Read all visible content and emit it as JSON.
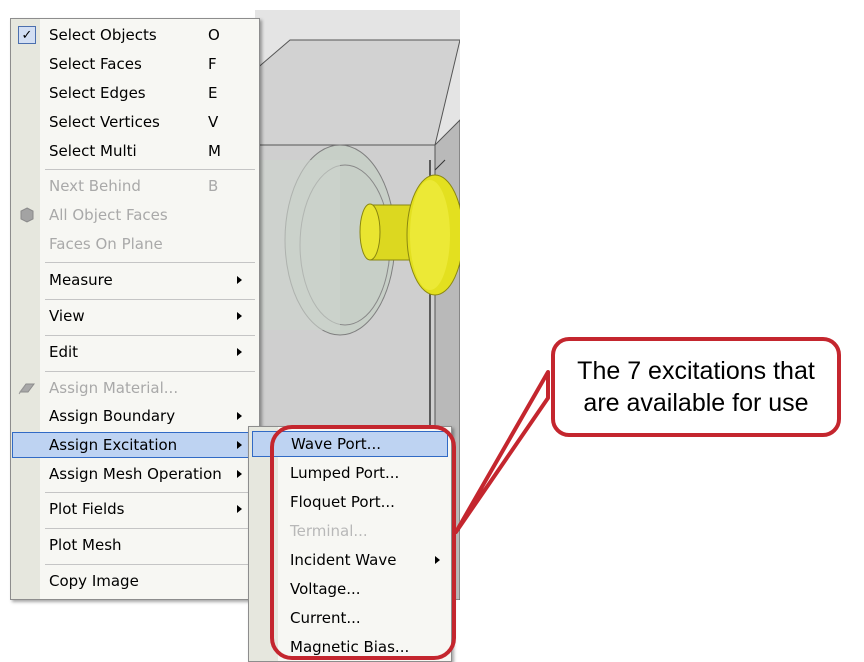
{
  "menu": {
    "items": [
      {
        "label": "Select Objects",
        "accel": "O",
        "checked": true
      },
      {
        "label": "Select Faces",
        "accel": "F"
      },
      {
        "label": "Select Edges",
        "accel": "E"
      },
      {
        "label": "Select Vertices",
        "accel": "V"
      },
      {
        "label": "Select Multi",
        "accel": "M"
      },
      {
        "label": "Next Behind",
        "accel": "B",
        "disabled": true
      },
      {
        "label": "All Object Faces",
        "disabled": true,
        "icon": "object-faces-icon"
      },
      {
        "label": "Faces On Plane",
        "disabled": true
      },
      {
        "label": "Measure",
        "submenu": true
      },
      {
        "label": "View",
        "submenu": true
      },
      {
        "label": "Edit",
        "submenu": true
      },
      {
        "label": "Assign Material...",
        "disabled": true,
        "icon": "material-icon"
      },
      {
        "label": "Assign Boundary",
        "submenu": true
      },
      {
        "label": "Assign Excitation",
        "submenu": true,
        "highlighted": true
      },
      {
        "label": "Assign Mesh Operation",
        "submenu": true
      },
      {
        "label": "Plot Fields",
        "submenu": true
      },
      {
        "label": "Plot Mesh"
      },
      {
        "label": "Copy Image"
      }
    ]
  },
  "submenu": {
    "items": [
      {
        "label": "Wave Port...",
        "highlighted": true
      },
      {
        "label": "Lumped Port..."
      },
      {
        "label": "Floquet Port..."
      },
      {
        "label": "Terminal...",
        "disabled": true
      },
      {
        "label": "Incident Wave",
        "submenu": true
      },
      {
        "label": "Voltage..."
      },
      {
        "label": "Current..."
      },
      {
        "label": "Magnetic Bias..."
      }
    ]
  },
  "callout": {
    "line1": "The 7 excitations that",
    "line2": "are available for use"
  },
  "colors": {
    "annotation": "#c4262e",
    "highlight": "#bed3f2",
    "highlight_border": "#316ac5",
    "coax_yellow": "#e3e01f"
  }
}
